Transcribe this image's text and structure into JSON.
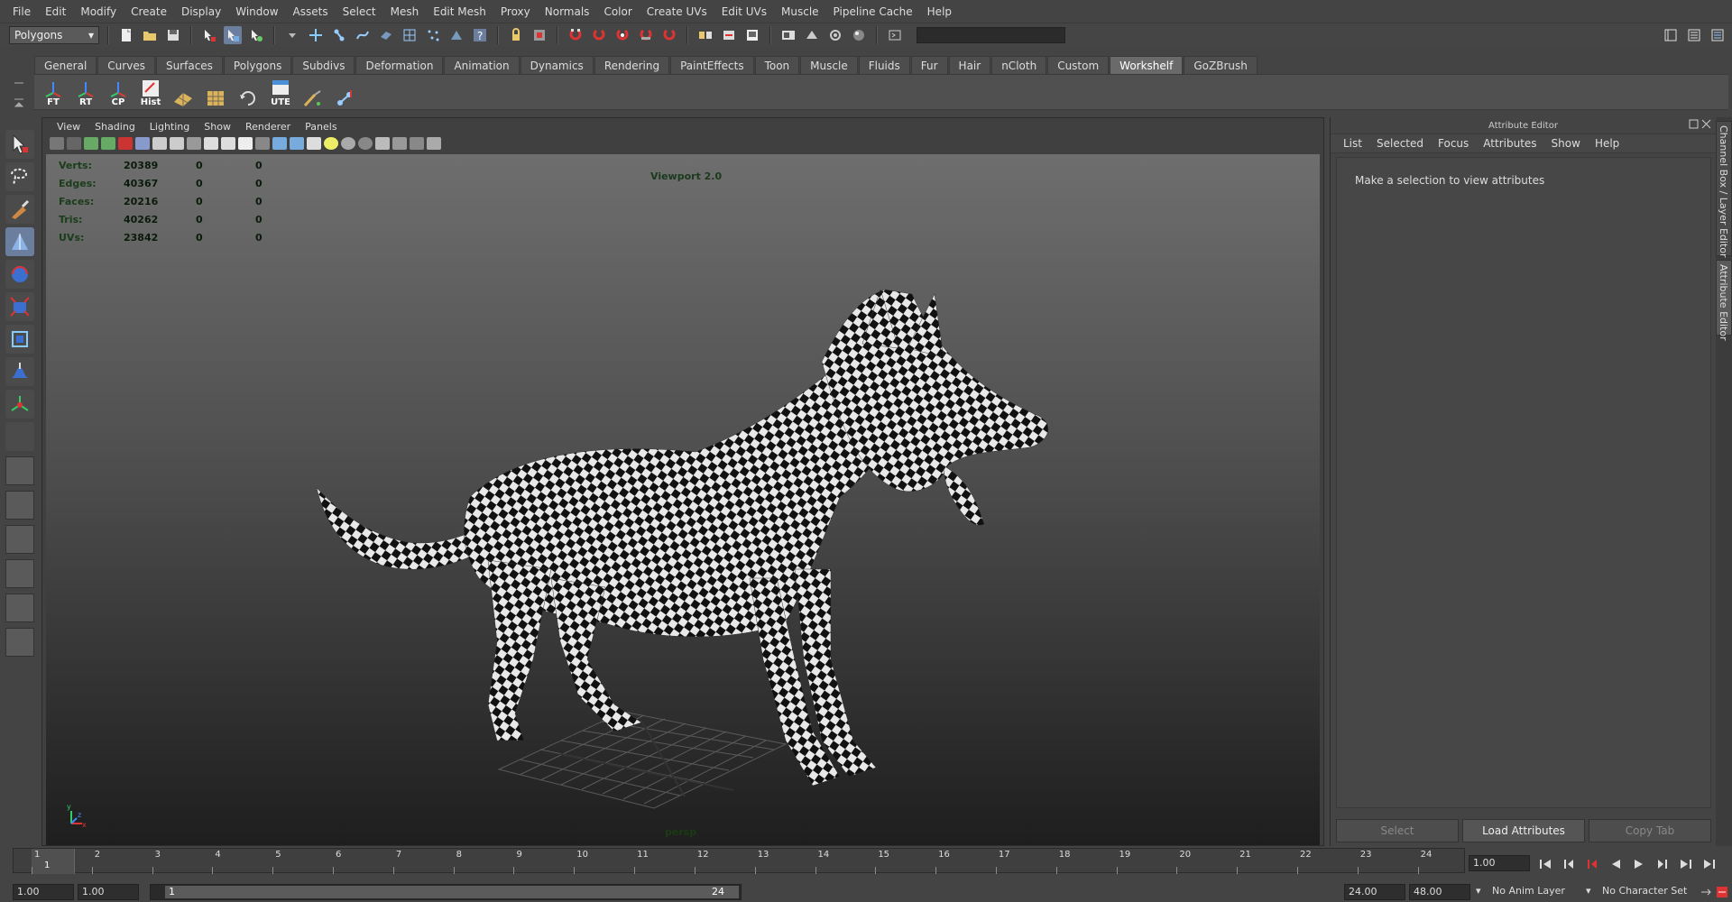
{
  "menubar": [
    "File",
    "Edit",
    "Modify",
    "Create",
    "Display",
    "Window",
    "Assets",
    "Select",
    "Mesh",
    "Edit Mesh",
    "Proxy",
    "Normals",
    "Color",
    "Create UVs",
    "Edit UVs",
    "Muscle",
    "Pipeline Cache",
    "Help"
  ],
  "status_line": {
    "mode": "Polygons"
  },
  "shelf": {
    "tabs": [
      "General",
      "Curves",
      "Surfaces",
      "Polygons",
      "Subdivs",
      "Deformation",
      "Animation",
      "Dynamics",
      "Rendering",
      "PaintEffects",
      "Toon",
      "Muscle",
      "Fluids",
      "Fur",
      "Hair",
      "nCloth",
      "Custom",
      "Workshelf",
      "GoZBrush"
    ],
    "active_tab": "Workshelf",
    "buttons": [
      {
        "label": "FT",
        "icon": "axis-icon"
      },
      {
        "label": "RT",
        "icon": "axis-icon"
      },
      {
        "label": "CP",
        "icon": "axis-icon"
      },
      {
        "label": "Hist",
        "icon": "history-icon"
      },
      {
        "label": "",
        "icon": "uv-planar-icon"
      },
      {
        "label": "",
        "icon": "uv-grid-icon"
      },
      {
        "label": "",
        "icon": "refresh-icon"
      },
      {
        "label": "UTE",
        "icon": "uv-texture-editor-icon"
      },
      {
        "label": "",
        "icon": "brush-icon"
      },
      {
        "label": "",
        "icon": "joint-icon"
      }
    ]
  },
  "viewport": {
    "menu": [
      "View",
      "Shading",
      "Lighting",
      "Show",
      "Renderer",
      "Panels"
    ],
    "renderer_label": "Viewport 2.0",
    "camera_label": "persp",
    "hud": [
      {
        "label": "Verts:",
        "value": "20389",
        "sel": "0",
        "comp": "0"
      },
      {
        "label": "Edges:",
        "value": "40367",
        "sel": "0",
        "comp": "0"
      },
      {
        "label": "Faces:",
        "value": "20216",
        "sel": "0",
        "comp": "0"
      },
      {
        "label": "Tris:",
        "value": "40262",
        "sel": "0",
        "comp": "0"
      },
      {
        "label": "UVs:",
        "value": "23842",
        "sel": "0",
        "comp": "0"
      }
    ],
    "axis_labels": {
      "y": "y",
      "x": "x",
      "z": "z"
    }
  },
  "attribute_editor": {
    "title": "Attribute Editor",
    "menu": [
      "List",
      "Selected",
      "Focus",
      "Attributes",
      "Show",
      "Help"
    ],
    "message": "Make a selection to view attributes",
    "buttons": {
      "select": "Select",
      "load": "Load Attributes",
      "copy": "Copy Tab"
    }
  },
  "side_tabs": {
    "channel_box": "Channel Box / Layer Editor",
    "attribute_editor": "Attribute Editor"
  },
  "time_slider": {
    "frames": [
      "1",
      "2",
      "3",
      "4",
      "5",
      "6",
      "7",
      "8",
      "9",
      "10",
      "11",
      "12",
      "13",
      "14",
      "15",
      "16",
      "17",
      "18",
      "19",
      "20",
      "21",
      "22",
      "23",
      "24"
    ],
    "current_frame": "1",
    "current_time": "1.00"
  },
  "range": {
    "start": "1.00",
    "playback_start": "1.00",
    "slider_start": "1",
    "slider_end": "24",
    "playback_end": "24.00",
    "end": "48.00",
    "anim_layer": "No Anim Layer",
    "character_set": "No Character Set"
  },
  "colors": {
    "accent": "#6b7e9e",
    "hud_text": "#1a3d1a",
    "viewport_top": "#6e6e6e",
    "viewport_bottom": "#1e1e1e"
  }
}
